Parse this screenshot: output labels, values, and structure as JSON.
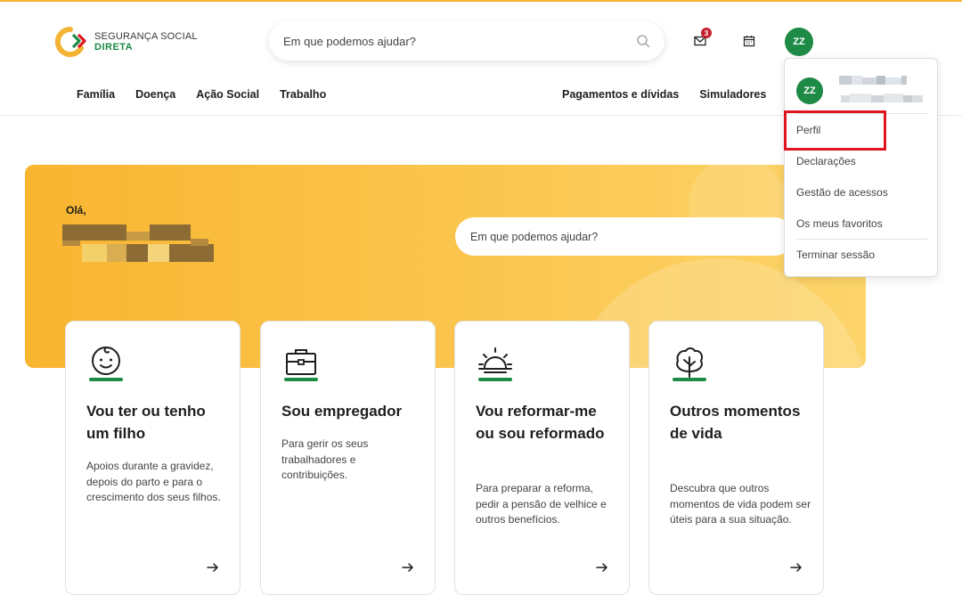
{
  "header": {
    "logo": {
      "line1": "SEGURANÇA SOCIAL",
      "line2": "DIRETA"
    },
    "search_placeholder": "Em que podemos ajudar?",
    "mail_badge": "3",
    "avatar_initials": "ZZ"
  },
  "nav": {
    "left": [
      "Família",
      "Doença",
      "Ação Social",
      "Trabalho"
    ],
    "right": [
      "Pagamentos e dívidas",
      "Simuladores"
    ]
  },
  "hero": {
    "greeting": "Olá,",
    "search_placeholder": "Em que podemos ajudar?"
  },
  "cards": [
    {
      "title": "Vou ter ou tenho um filho",
      "description": "Apoios durante a gravidez, depois do parto e para o crescimento dos seus filhos.",
      "icon": "baby-face-icon"
    },
    {
      "title": "Sou empregador",
      "description": "Para gerir os seus trabalhadores e contribuições.",
      "icon": "briefcase-icon"
    },
    {
      "title": "Vou reformar-me ou sou reformado",
      "description": "Para preparar a reforma, pedir a pensão de velhice e outros benefícios.",
      "icon": "sunset-icon"
    },
    {
      "title": "Outros momentos de vida",
      "description": "Descubra que outros momentos de vida podem ser úteis para a sua situação.",
      "icon": "tree-icon"
    }
  ],
  "dropdown": {
    "avatar_initials": "ZZ",
    "items": [
      "Perfil",
      "Declarações",
      "Gestão de acessos",
      "Os meus favoritos",
      "Terminar sessão"
    ]
  },
  "colors": {
    "brand_green": "#1d8a45",
    "hero_yellow": "#f8b530",
    "highlight_red": "#e0141e",
    "badge_red": "#c3202b"
  }
}
